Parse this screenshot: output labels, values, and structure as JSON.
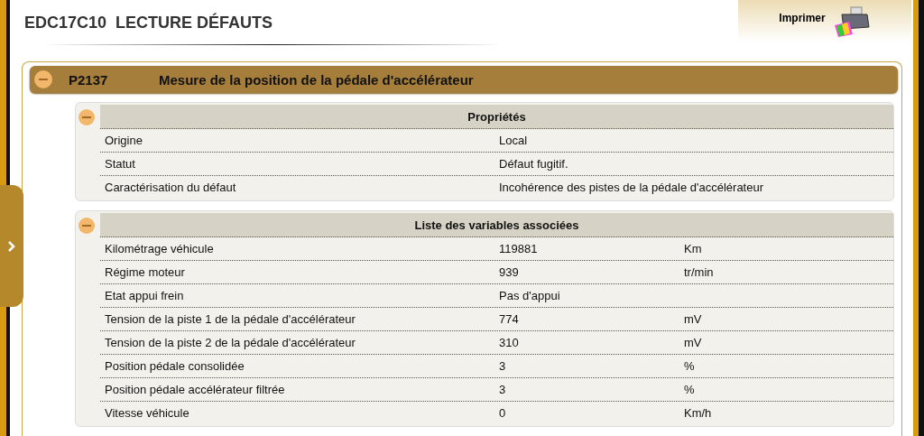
{
  "page_title": "EDC17C10  LECTURE DÉFAUTS",
  "print_button": {
    "label": "Imprimer"
  },
  "fault": {
    "code": "P2137",
    "description": "Mesure de la position de la pédale d'accélérateur",
    "expanded": true,
    "sections": [
      {
        "title": "Propriétés",
        "expanded": true,
        "rows": [
          {
            "label": "Origine",
            "value": "Local"
          },
          {
            "label": "Statut",
            "value": "Défaut fugitif."
          },
          {
            "label": "Caractérisation du défaut",
            "value": "Incohérence des pistes de la pédale d'accélérateur"
          }
        ]
      },
      {
        "title": "Liste des variables associées",
        "expanded": true,
        "rows": [
          {
            "label": "Kilométrage véhicule",
            "value": "119881",
            "unit": "Km"
          },
          {
            "label": "Régime moteur",
            "value": "939",
            "unit": "tr/min"
          },
          {
            "label": "Etat appui frein",
            "value": "Pas d'appui"
          },
          {
            "label": "Tension de la piste 1 de la pédale d'accélérateur",
            "value": "774",
            "unit": "mV"
          },
          {
            "label": "Tension de la piste 2 de la pédale d'accélérateur",
            "value": "310",
            "unit": "mV"
          },
          {
            "label": "Position pédale consolidée",
            "value": "3",
            "unit": "%"
          },
          {
            "label": "Position pédale accélérateur filtrée",
            "value": "3",
            "unit": "%"
          },
          {
            "label": "Vitesse véhicule",
            "value": "0",
            "unit": "Km/h"
          }
        ]
      }
    ]
  }
}
